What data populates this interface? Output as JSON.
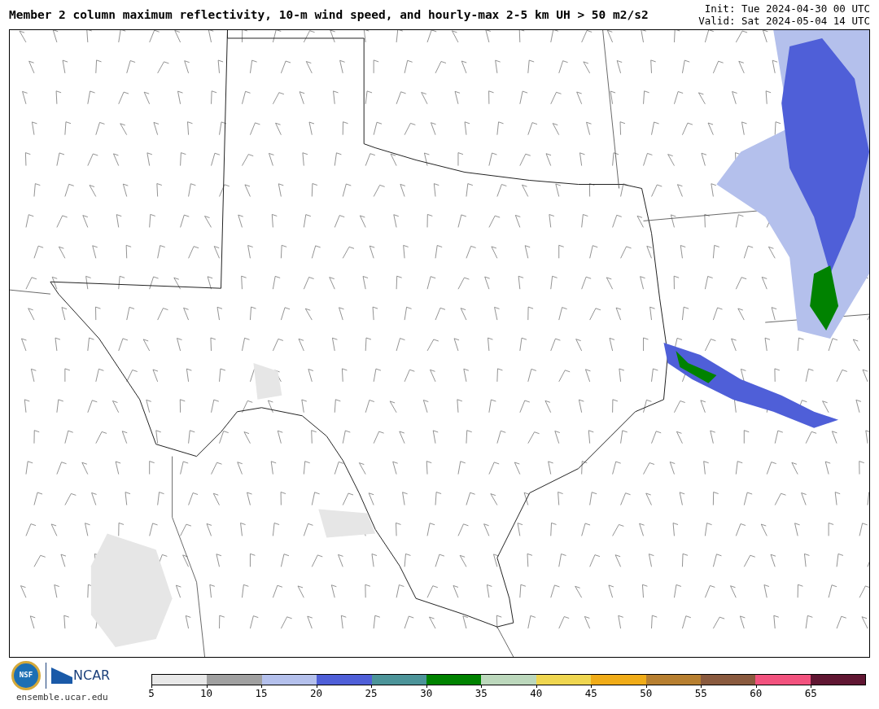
{
  "title": "Member 2 column maximum reflectivity, 10-m wind speed, and hourly-max 2-5 km UH > 50 m2/s2",
  "init": "Init: Tue 2024-04-30 00 UTC",
  "valid": "Valid: Sat 2024-05-04 14 UTC",
  "logos": {
    "nsf": "NSF",
    "ncar": "NCAR",
    "url": "ensemble.ucar.edu"
  },
  "colorbar": [
    {
      "color": "#e8e8e8",
      "label": "5"
    },
    {
      "color": "#a0a0a0",
      "label": "10"
    },
    {
      "color": "#b4c0ec",
      "label": "15"
    },
    {
      "color": "#4f5fd8",
      "label": "20"
    },
    {
      "color": "#4c9499",
      "label": "25"
    },
    {
      "color": "#008200",
      "label": "30"
    },
    {
      "color": "#bcd8bc",
      "label": "35"
    },
    {
      "color": "#efd650",
      "label": "40"
    },
    {
      "color": "#f0ac18",
      "label": "45"
    },
    {
      "color": "#b77f30",
      "label": "50"
    },
    {
      "color": "#8a5a3e",
      "label": "55"
    },
    {
      "color": "#f2527e",
      "label": "60"
    },
    {
      "color": "#601632",
      "label": "65"
    }
  ]
}
